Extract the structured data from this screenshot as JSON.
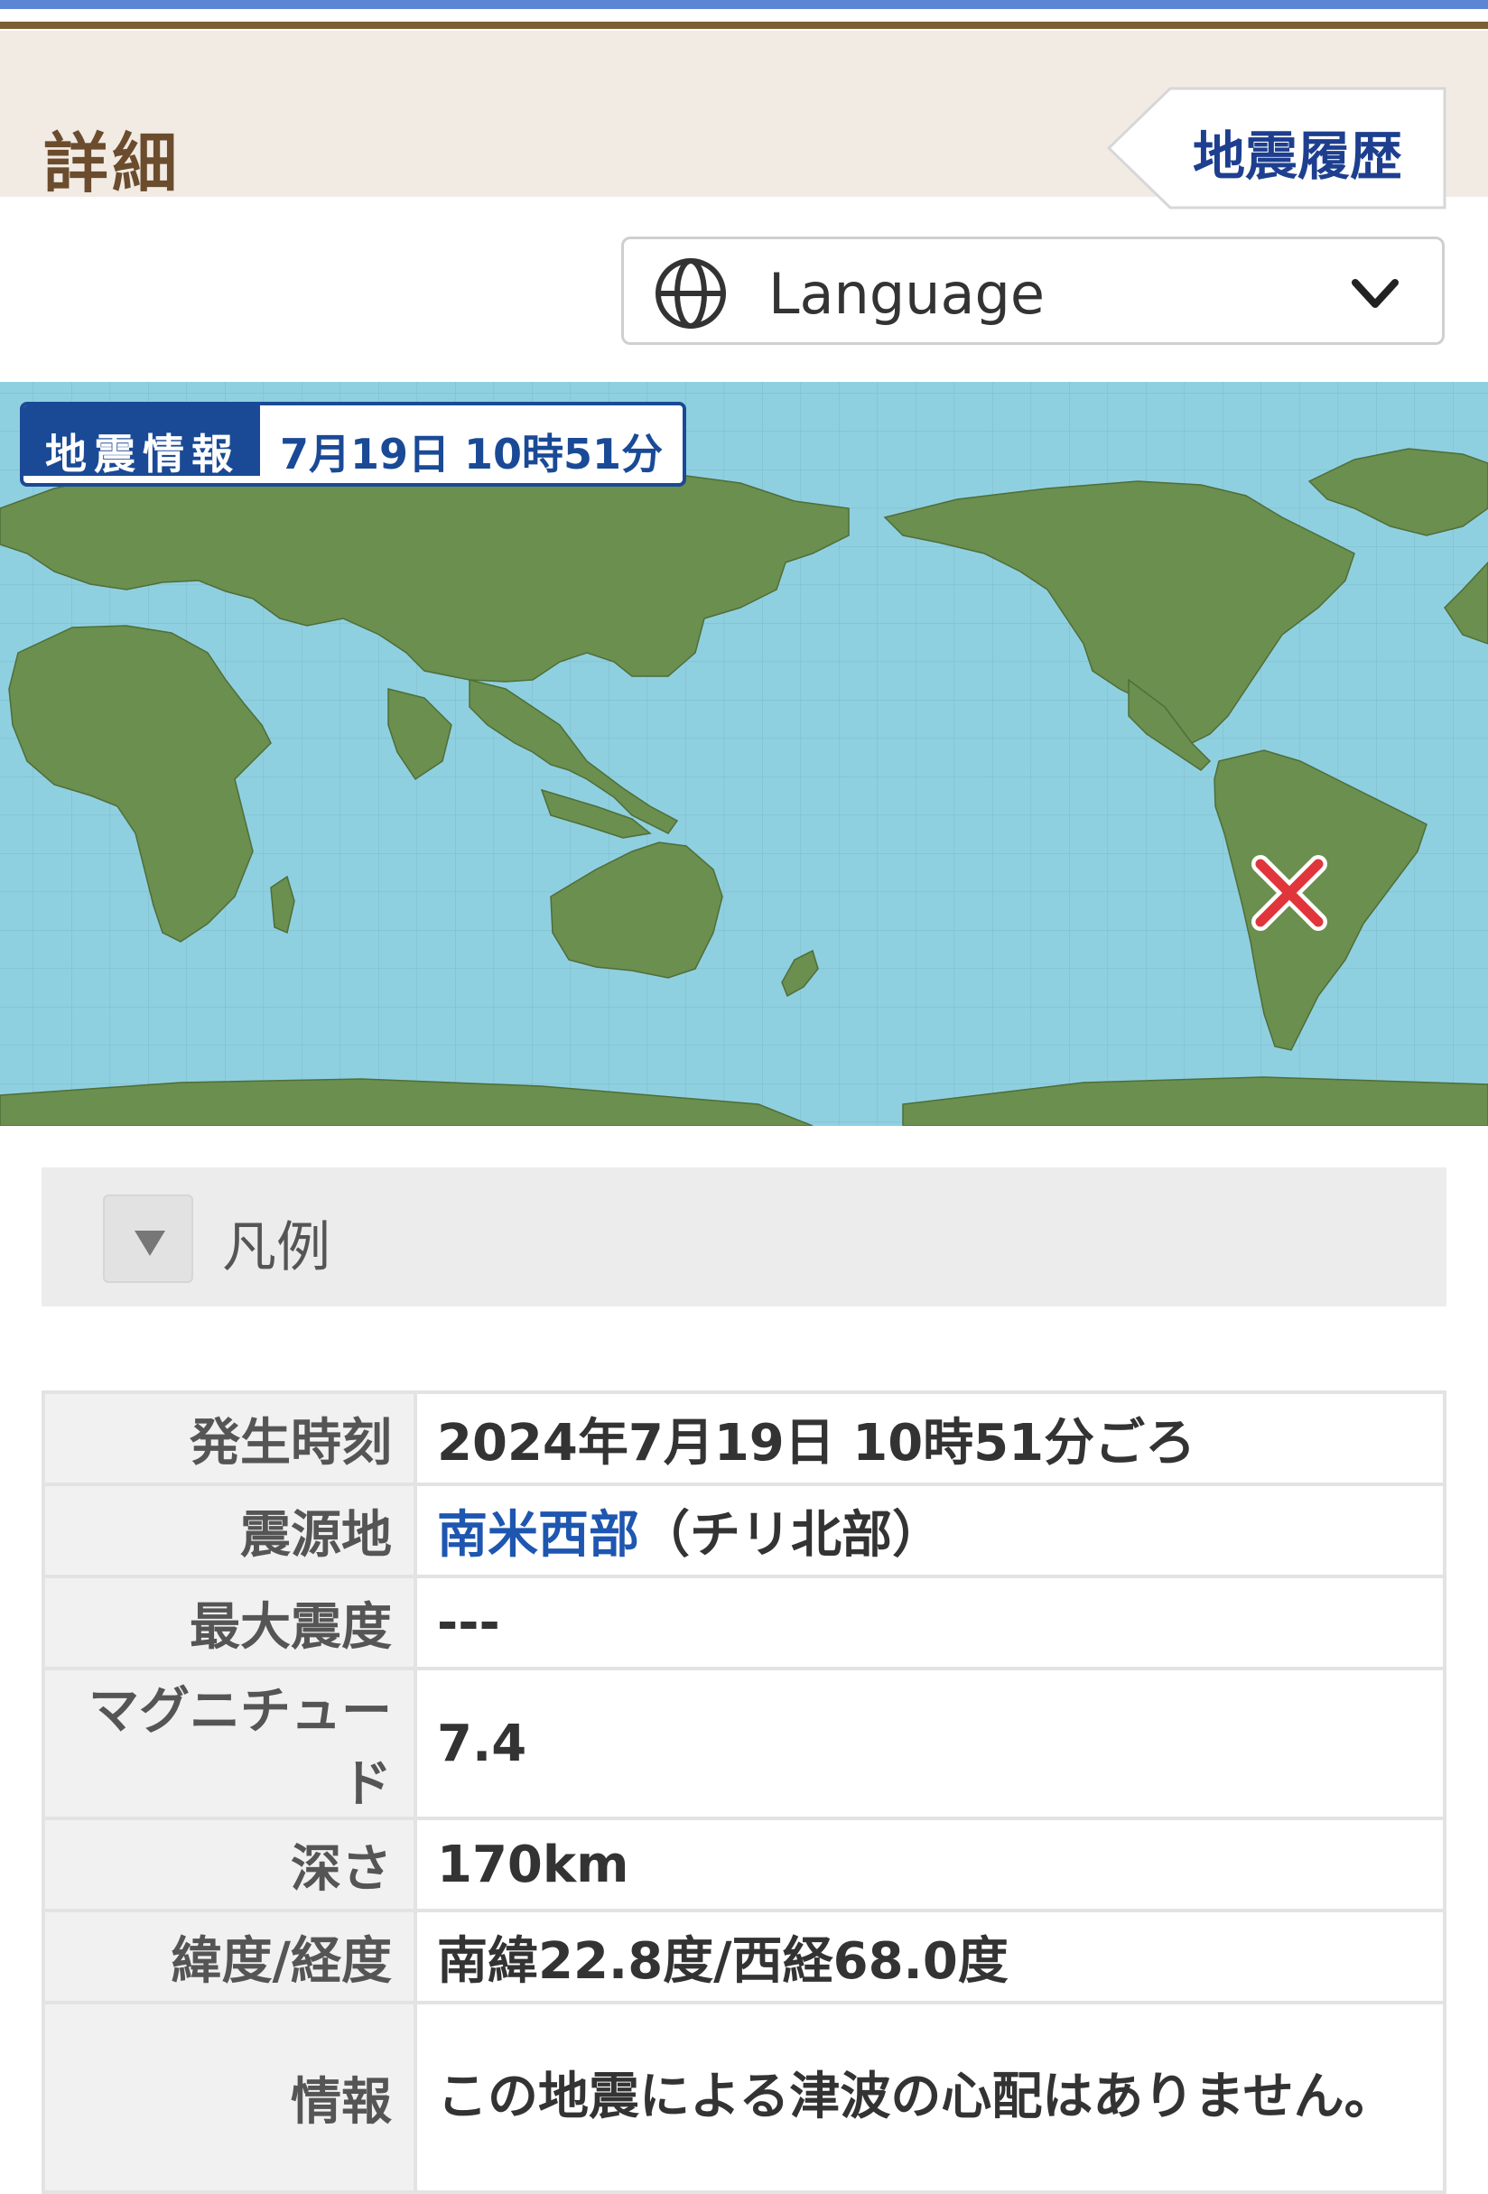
{
  "header": {
    "title": "詳細",
    "history_button": "地震履歴"
  },
  "language_select": {
    "label": "Language",
    "icon": "globe-icon"
  },
  "map": {
    "tag_label": "地震情報",
    "tag_time": "7月19日 10時51分",
    "epicenter_icon": "x-mark-icon",
    "epicenter_color": "#e0363b",
    "land_color": "#6b8f4e",
    "sea_color": "#8fd0e0"
  },
  "legend": {
    "label": "凡例"
  },
  "details": {
    "occurred_label": "発生時刻",
    "occurred_value": "2024年7月19日 10時51分ごろ",
    "epicenter_label": "震源地",
    "epicenter_region": "南米西部",
    "epicenter_detail": "（チリ北部）",
    "intensity_label": "最大震度",
    "intensity_value": "---",
    "magnitude_label": "マグニチュード",
    "magnitude_value": "7.4",
    "depth_label": "深さ",
    "depth_value": "170km",
    "latlon_label": "緯度/経度",
    "latlon_value": "南緯22.8度/西経68.0度",
    "info_label": "情報",
    "info_value": "この地震による津波の心配はありません。"
  }
}
